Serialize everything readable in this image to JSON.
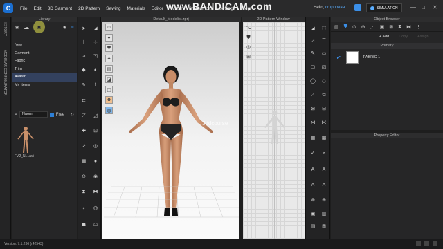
{
  "app": {
    "logo_letter": "C",
    "menu": [
      "File",
      "Edit",
      "3D Garment",
      "2D Pattern",
      "Sewing",
      "Materials",
      "Editor",
      "Avatar",
      "Preferences",
      "Settings",
      "Help"
    ],
    "watermark": "www.BANDICAM.com",
    "greeting": "Hello,",
    "username": "crupnovaa",
    "mode_button": "SIMULATION",
    "window_controls": [
      "—",
      "□",
      "✕"
    ]
  },
  "left_tabs": [
    "HISTORY",
    "MODULAR CONFIGURATOR"
  ],
  "library": {
    "title": "Library",
    "items": [
      "New",
      "Garment",
      "Fabric",
      "Trim",
      "Avatar",
      "My Items"
    ],
    "active_item": "Avatar",
    "search_value": "Naomi",
    "free_label": "Free",
    "thumbnail_label": "FV2_N....avt"
  },
  "viewport": {
    "title": "Default_Modelist.zprj",
    "overlay_text": "3ddcourse"
  },
  "pattern_window": {
    "title": "2D Pattern Window"
  },
  "object_browser": {
    "title": "Object Browser",
    "add_label": "+ Add",
    "copy_label": "Copy",
    "assign_label": "Assign",
    "group_label": "Primary",
    "fabric_name": "FABRIC 1",
    "fabric_color": "#ffffff"
  },
  "property_editor": {
    "title": "Property Editor"
  },
  "status": {
    "version": "Version: 7.1.236 (r42543)"
  },
  "colors": {
    "accent": "#3b8fe8",
    "active_row": "#33415e",
    "highlight": "#e6e650"
  }
}
